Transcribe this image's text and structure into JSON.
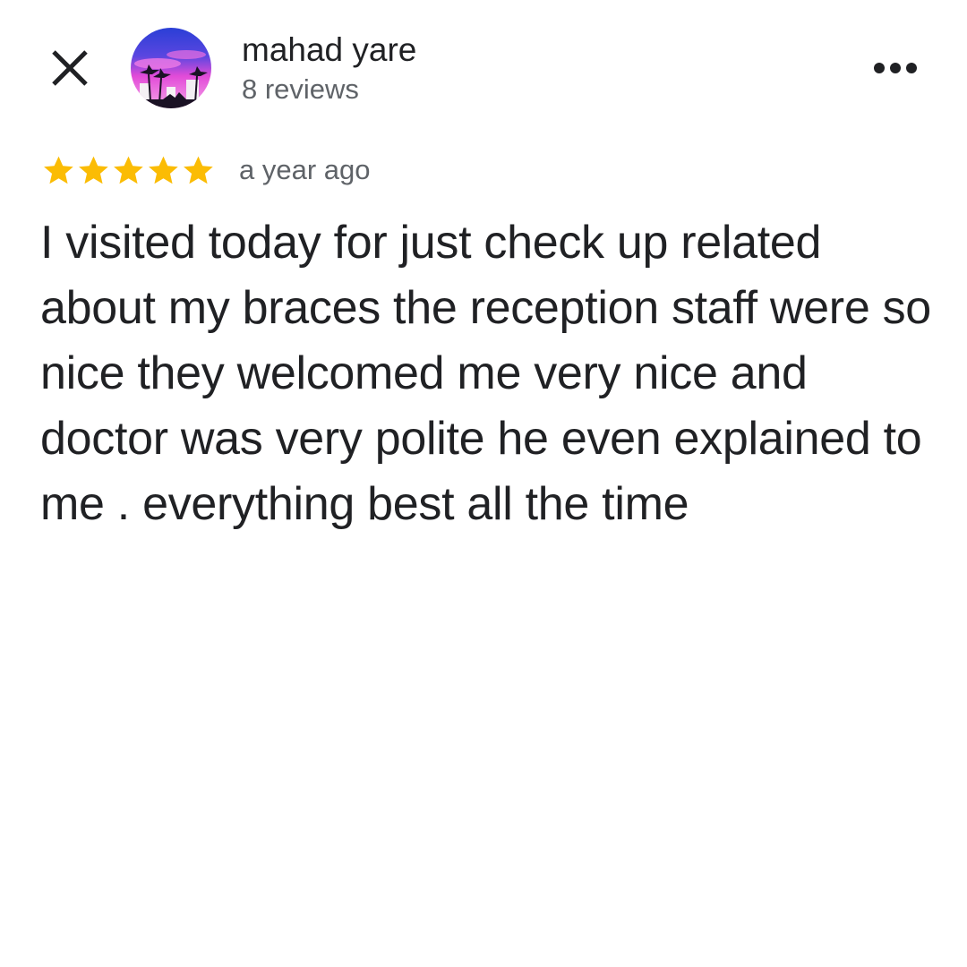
{
  "header": {
    "close_icon": "close-icon",
    "more_icon": "more-horizontal-icon",
    "avatar_icon": "avatar-palm-trees-sunset"
  },
  "reviewer": {
    "name": "mahad yare",
    "review_count": "8 reviews"
  },
  "review": {
    "rating": 5,
    "rating_max": 5,
    "star_color": "#fbbc04",
    "timestamp": "a year ago",
    "text": "I visited today for just check up related about my braces the reception staff were so nice they welcomed me very nice and doctor was very polite he even explained to me . everything best all the time"
  }
}
